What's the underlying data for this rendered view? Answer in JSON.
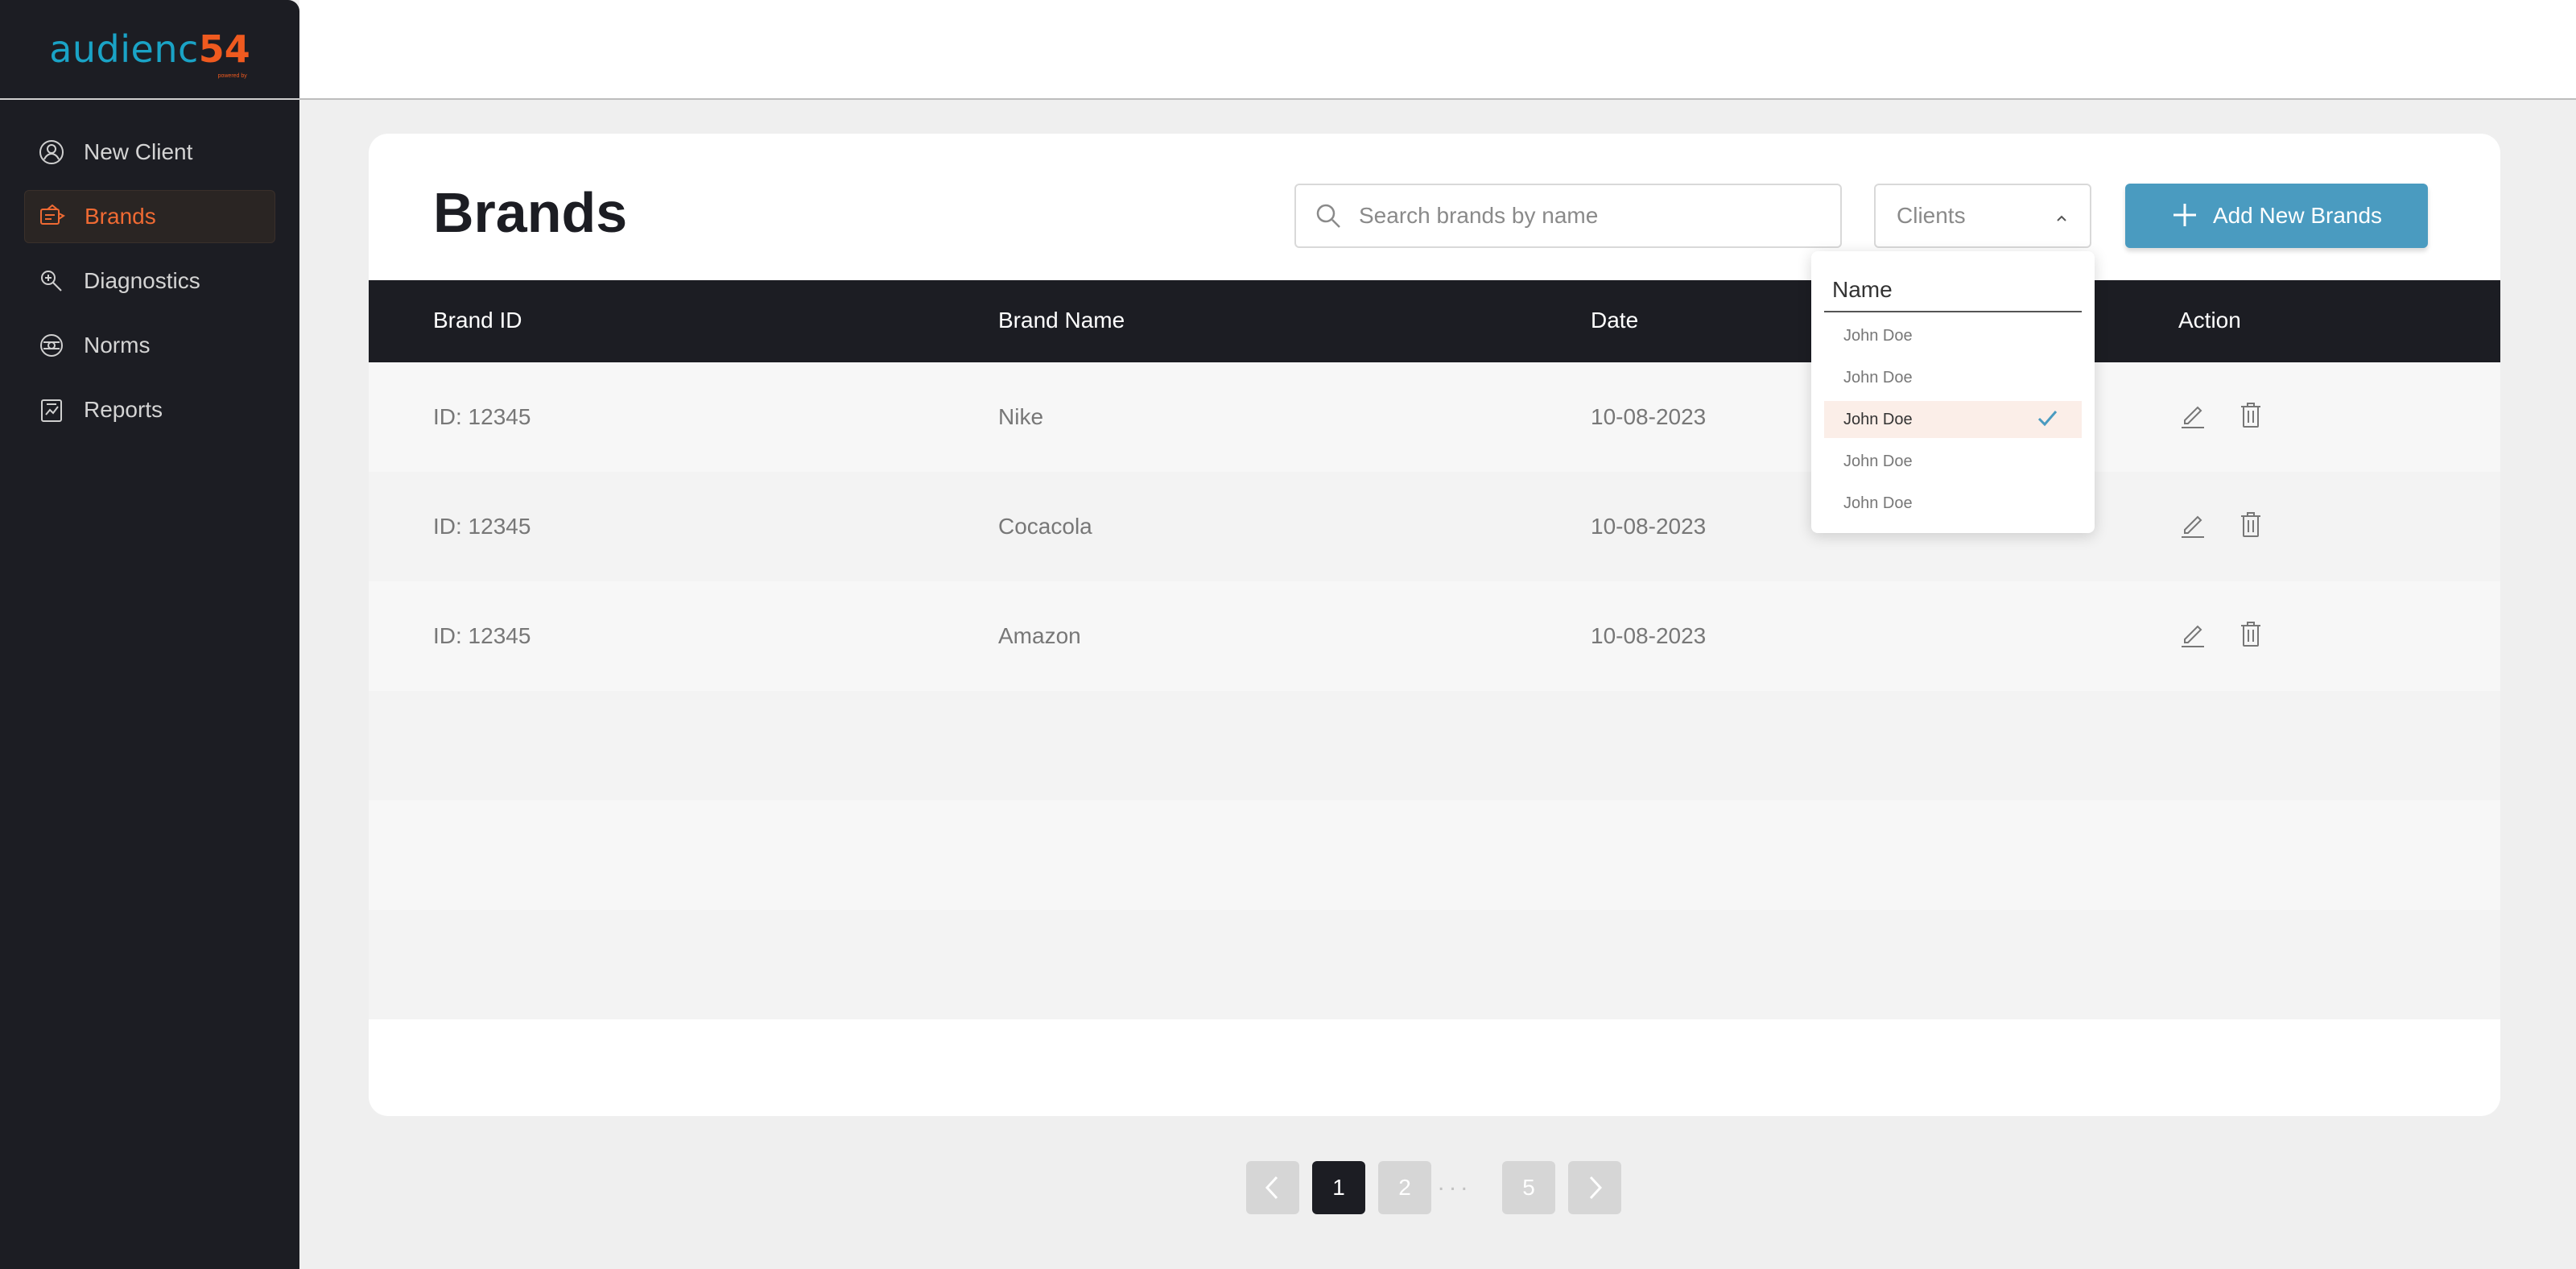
{
  "logo": {
    "text": "audienc",
    "accent": "54",
    "sub": "powered by"
  },
  "sidebar": {
    "items": [
      {
        "label": "New Client",
        "icon": "new-client-icon",
        "active": false
      },
      {
        "label": "Brands",
        "icon": "brands-icon",
        "active": true
      },
      {
        "label": "Diagnostics",
        "icon": "diagnostics-icon",
        "active": false
      },
      {
        "label": "Norms",
        "icon": "norms-icon",
        "active": false
      },
      {
        "label": "Reports",
        "icon": "reports-icon",
        "active": false
      }
    ]
  },
  "page": {
    "title": "Brands"
  },
  "search": {
    "placeholder": "Search brands by name",
    "value": ""
  },
  "clients_select": {
    "label": "Clients"
  },
  "add_button": {
    "label": "Add New Brands"
  },
  "table": {
    "headers": {
      "id": "Brand ID",
      "name": "Brand Name",
      "date": "Date",
      "action": "Action"
    },
    "rows": [
      {
        "id": "ID: 12345",
        "name": "Nike",
        "date": "10-08-2023"
      },
      {
        "id": "ID: 12345",
        "name": "Cocacola",
        "date": "10-08-2023"
      },
      {
        "id": "ID: 12345",
        "name": "Amazon",
        "date": "10-08-2023"
      }
    ]
  },
  "dropdown": {
    "header": "Name",
    "options": [
      "John Doe",
      "John Doe",
      "John Doe",
      "John Doe",
      "John Doe"
    ],
    "selected_index": 2
  },
  "pagination": {
    "pages": [
      "1",
      "2",
      "5"
    ],
    "current": "1",
    "ellipsis": "..."
  },
  "colors": {
    "sidebar_bg": "#1c1d23",
    "accent_orange": "#ef6a33",
    "accent_blue": "#4a9bc0",
    "logo_blue": "#1aa3c6"
  }
}
